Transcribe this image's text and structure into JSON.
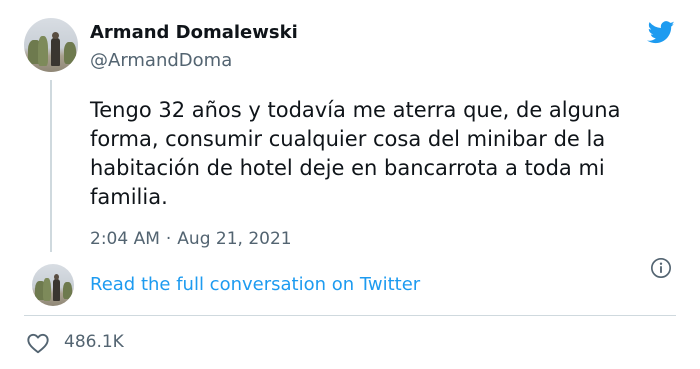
{
  "author": {
    "display_name": "Armand Domalewski",
    "handle": "@ArmandDoma",
    "avatar_icon": "avatar-photo"
  },
  "tweet": {
    "text": "Tengo 32 años y todavía me aterra que, de alguna forma, consumir cualquier cosa del minibar de la habitación de hotel deje en bancarrota a toda mi familia.",
    "time": "2:04 AM",
    "separator": "·",
    "date": "Aug 21, 2021"
  },
  "conversation": {
    "link_text": "Read the full conversation on Twitter"
  },
  "engagement": {
    "like_count": "486.1K"
  },
  "colors": {
    "brand_blue": "#1d9bf0",
    "text_primary": "#0f1419",
    "text_secondary": "#536471",
    "border": "#cfd9de"
  },
  "icons": {
    "brand": "twitter-bird-icon",
    "info": "info-icon",
    "like": "heart-icon"
  }
}
